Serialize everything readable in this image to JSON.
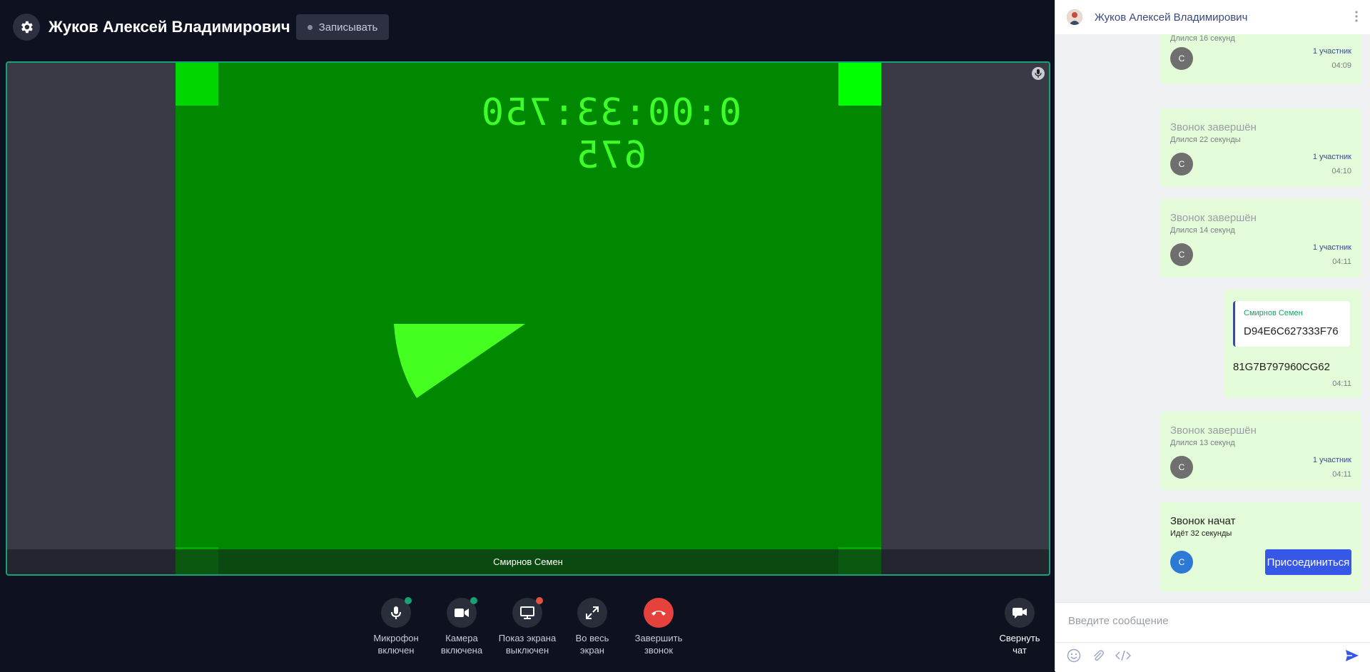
{
  "call": {
    "title": "Жуков Алексей Владимирович",
    "record_label": "Записывать",
    "video": {
      "timecode": "0:00:33:750 675",
      "participant_name": "Смирнов Семен"
    },
    "controls": [
      {
        "name": "microphone-toggle",
        "label_line1": "Микрофон",
        "label_line2": "включен",
        "icon": "microphone-icon",
        "badge_color": "#19a079"
      },
      {
        "name": "camera-toggle",
        "label_line1": "Камера",
        "label_line2": "включена",
        "icon": "video-camera-icon",
        "badge_color": "#19a079"
      },
      {
        "name": "screen-share-toggle",
        "label_line1": "Показ экрана",
        "label_line2": "выключен",
        "icon": "monitor-icon",
        "badge_color": "#e5533d"
      },
      {
        "name": "fullscreen-button",
        "label_line1": "Во весь",
        "label_line2": "экран",
        "icon": "expand-icon"
      },
      {
        "name": "end-call-button",
        "label_line1": "Завершить",
        "label_line2": "звонок",
        "icon": "phone-hangup-icon",
        "button_color": "#e5413d"
      },
      {
        "name": "collapse-chat-button",
        "label_line1": "Свернуть",
        "label_line2": "чат",
        "icon": "video-chat-icon"
      }
    ]
  },
  "chat": {
    "title": "Жуков Алексей Владимирович",
    "messages": [
      {
        "title": "",
        "subtitle": "Длился 16 секунд",
        "avatar": "С",
        "participants": "1 участник",
        "time": "04:09"
      },
      {
        "title": "Звонок завершён",
        "subtitle": "Длился 22 секунды",
        "avatar": "С",
        "participants": "1 участник",
        "time": "04:10"
      },
      {
        "title": "Звонок завершён",
        "subtitle": "Длился 14 секунд",
        "avatar": "С",
        "participants": "1 участник",
        "time": "04:11"
      },
      {
        "title": "Звонок завершён",
        "subtitle": "Длился 13 секунд",
        "avatar": "С",
        "participants": "1 участник",
        "time": "04:11"
      }
    ],
    "reply": {
      "quote_name": "Смирнов Семен",
      "quote_text": "D94E6C627333F76",
      "text": "81G7B797960CG62",
      "time": "04:11"
    },
    "active_call": {
      "title": "Звонок начат",
      "subtitle": "Идёт 32 секунды",
      "avatar": "С",
      "join_label": "Присоединиться"
    },
    "compose_placeholder": "Введите сообщение"
  }
}
